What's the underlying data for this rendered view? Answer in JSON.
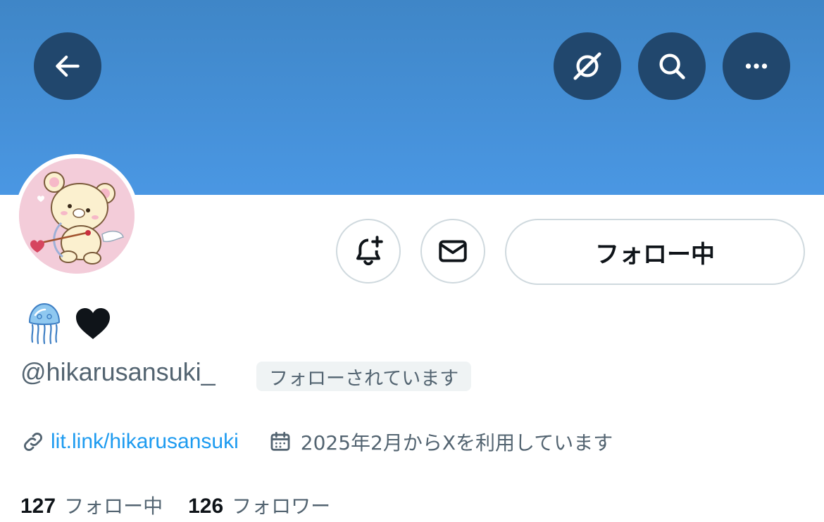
{
  "header": {
    "back_icon": "arrow-left-icon",
    "grok_icon": "grok-slash-icon",
    "search_icon": "search-icon",
    "more_icon": "more-horizontal-icon",
    "banner_color": "#4a97e3",
    "button_color": "#21476d"
  },
  "profile": {
    "display_name_emojis": [
      "🪼",
      "🖤"
    ],
    "handle": "@hikarusansuki_",
    "follows_you_badge": "フォローされています",
    "website": "lit.link/hikarusansuki",
    "joined": "2025年2月からXを利用しています",
    "following_count": "127",
    "following_label": "フォロー中",
    "followers_count": "126",
    "followers_label": "フォロワー"
  },
  "actions": {
    "notify_icon": "bell-plus-icon",
    "message_icon": "mail-icon",
    "follow_button_label": "フォロー中"
  },
  "colors": {
    "link": "#1d9bf0",
    "muted": "#536471",
    "text": "#0f1419"
  }
}
